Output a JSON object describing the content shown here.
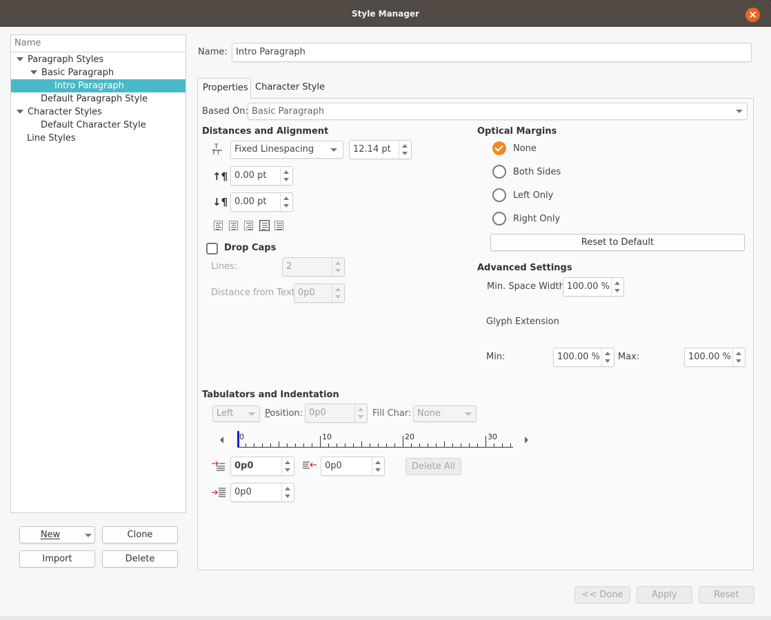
{
  "window": {
    "title": "Style Manager"
  },
  "tree": {
    "header": "Name",
    "items": [
      {
        "label": "Paragraph Styles",
        "expanded": true,
        "selected": false
      },
      {
        "label": "Basic Paragraph",
        "expanded": true,
        "selected": false
      },
      {
        "label": "Intro Paragraph",
        "selected": true
      },
      {
        "label": "Default Paragraph Style",
        "selected": false
      },
      {
        "label": "Character Styles",
        "expanded": true,
        "selected": false
      },
      {
        "label": "Default Character Style",
        "selected": false
      },
      {
        "label": "Line Styles",
        "selected": false
      }
    ]
  },
  "left_buttons": {
    "new": "New",
    "clone": "Clone",
    "import": "Import",
    "delete": "Delete"
  },
  "name_field": {
    "label": "Name:",
    "value": "Intro Paragraph"
  },
  "tabs": [
    {
      "label": "Properties",
      "active": true
    },
    {
      "label": "Character Style",
      "active": false
    }
  ],
  "based_on": {
    "label": "Based On:",
    "value": "Basic Paragraph"
  },
  "distances": {
    "heading": "Distances and Alignment",
    "linespacing_mode": "Fixed Linespacing",
    "linespacing_value": "12.14 pt",
    "space_above": "0.00 pt",
    "space_below": "0.00 pt",
    "alignment_icons": [
      "align-left-icon",
      "align-center-icon",
      "align-right-icon",
      "align-justify-icon",
      "align-forced-justify-icon"
    ],
    "selected_alignment": 3
  },
  "drop_caps": {
    "label": "Drop Caps",
    "checked": false,
    "lines_label": "Lines:",
    "lines_value": "2",
    "distance_label": "Distance from Text:",
    "distance_value": "0p0"
  },
  "optical_margins": {
    "heading": "Optical Margins",
    "options": [
      "None",
      "Both Sides",
      "Left Only",
      "Right Only"
    ],
    "selected": 0,
    "reset_label": "Reset to Default"
  },
  "advanced": {
    "heading": "Advanced Settings",
    "min_space_label": "Min. Space Width:",
    "min_space_value": "100.00 %",
    "glyph_label": "Glyph Extension",
    "min_label": "Min:",
    "min_value": "100.00 %",
    "max_label": "Max:",
    "max_value": "100.00 %"
  },
  "tabulators": {
    "heading": "Tabulators and Indentation",
    "type_value": "Left",
    "position_label": "Position:",
    "position_value": "0p0",
    "fill_label": "Fill Char:",
    "fill_value": "None",
    "ruler_labels": [
      "0",
      "10",
      "20",
      "30"
    ],
    "first_indent": "0p0",
    "right_indent": "0p0",
    "left_indent": "0p0",
    "delete_all": "Delete All"
  },
  "footer": {
    "done": "<< Done",
    "apply": "Apply",
    "reset": "Reset"
  },
  "colors": {
    "accent": "#f08a24",
    "selection": "#48b9c7",
    "titlebar": "#524a45"
  }
}
